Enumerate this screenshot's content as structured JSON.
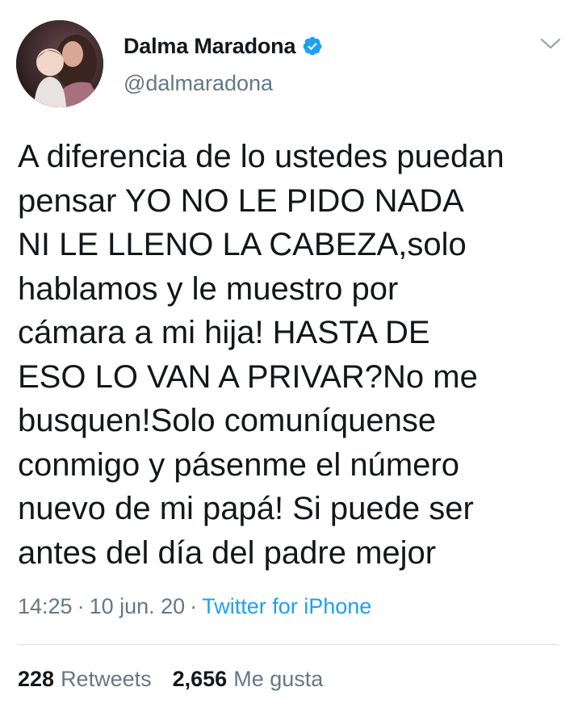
{
  "user": {
    "display_name": "Dalma Maradona",
    "handle": "@dalmaradona",
    "verified": true
  },
  "tweet": {
    "lines": [
      "A diferencia de lo ustedes puedan",
      "pensar YO NO LE PIDO NADA",
      "NI LE LLENO LA CABEZA,solo",
      "hablamos y le muestro por",
      "cámara a mi hija! HASTA DE",
      "ESO LO VAN A PRIVAR?No me",
      "busquen!Solo comuníquense",
      "conmigo y pásenme el número",
      "nuevo de mi papá! Si puede ser",
      "antes del día del padre mejor"
    ],
    "time": "14:25",
    "separator": "·",
    "date": "10 jun. 20",
    "source": "Twitter for iPhone"
  },
  "stats": {
    "retweets_count": "228",
    "retweets_label": "Retweets",
    "likes_count": "2,656",
    "likes_label": "Me gusta"
  },
  "colors": {
    "text": "#14171a",
    "secondary": "#657786",
    "accent": "#1da1f2",
    "divider": "#d9dee2"
  },
  "icons": {
    "verified": "verified-badge-icon",
    "more": "chevron-down-icon"
  }
}
